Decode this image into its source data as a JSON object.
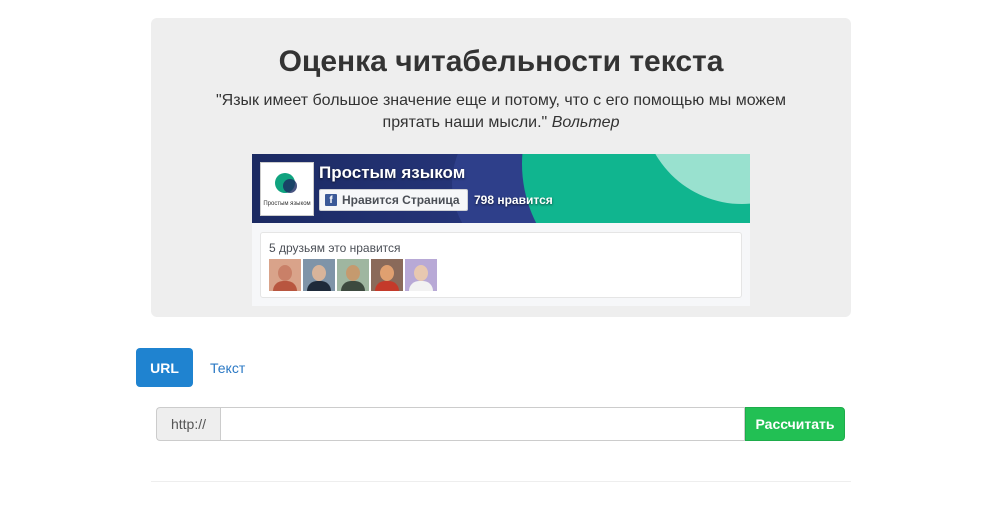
{
  "header": {
    "title": "Оценка читабельности текста",
    "quote": "\"Язык имеет большое значение еще и потому, что с его помощью мы можем прятать наши мысли.\"",
    "quote_author": "Вольтер"
  },
  "fb_widget": {
    "page_name": "Простым языком",
    "logo_caption": "Простым языком",
    "like_button_label": "Нравится Страница",
    "like_icon": "facebook-f-icon",
    "like_count": "798 нравится",
    "friends_text": "5 друзьям это нравится",
    "friend_avatar_count": 5,
    "colors": {
      "cover": "#27367c",
      "accent": "#10b58f",
      "fb_blue": "#3b5998"
    }
  },
  "tabs": [
    {
      "label": "URL",
      "active": true
    },
    {
      "label": "Текст",
      "active": false
    }
  ],
  "url_form": {
    "prefix": "http://",
    "value": "",
    "placeholder": "",
    "submit_label": "Рассчитать"
  },
  "colors": {
    "primary": "#1f83d0",
    "success": "#22c054",
    "jumbotron_bg": "#eeeeee"
  }
}
